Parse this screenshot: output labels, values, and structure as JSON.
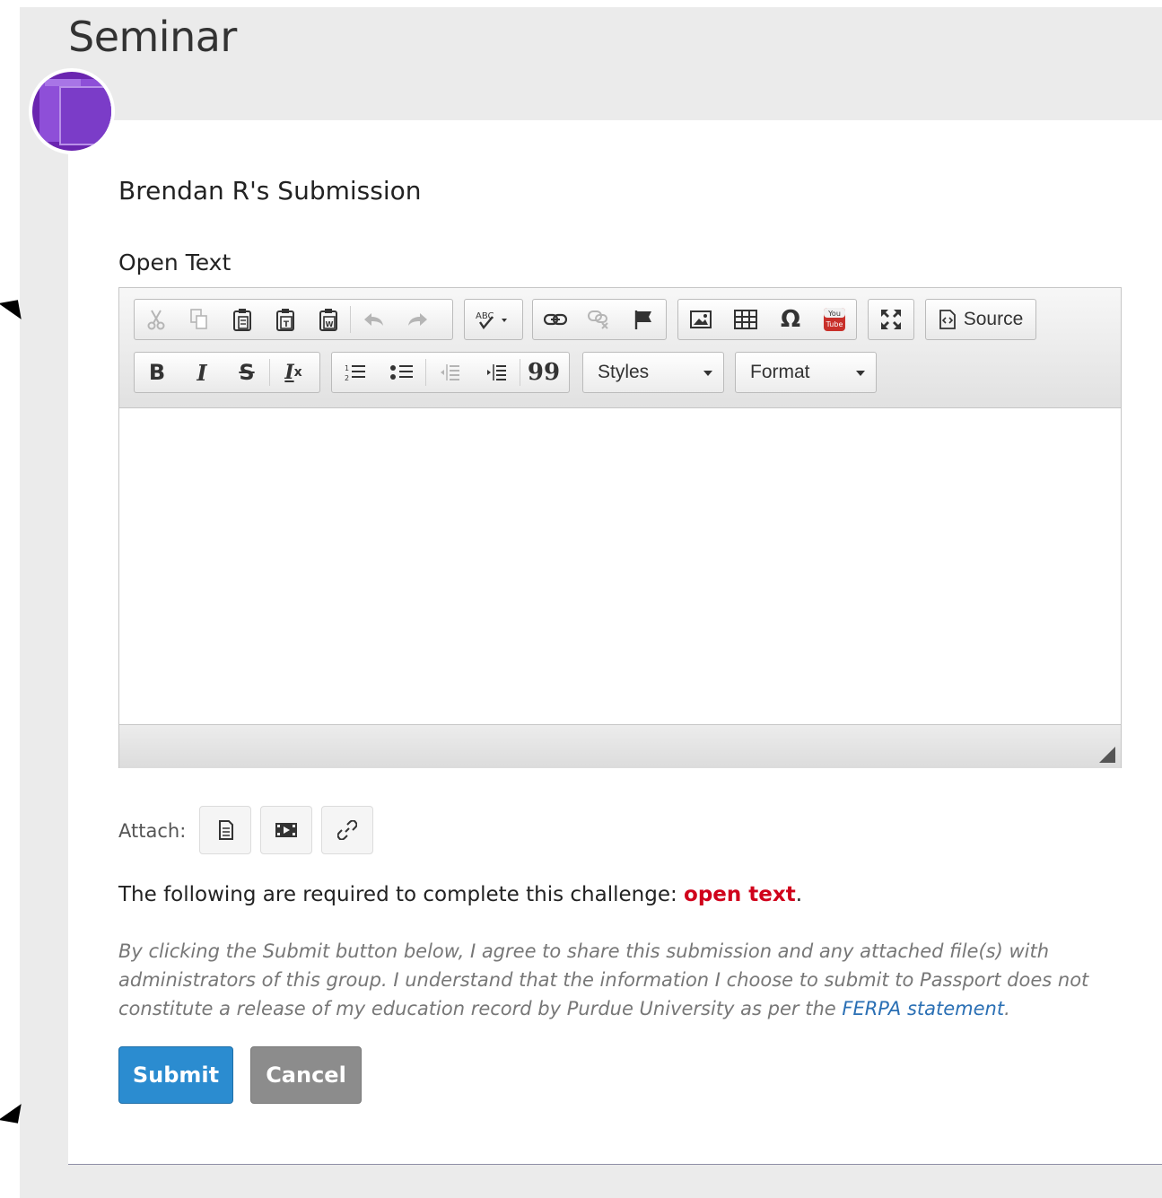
{
  "page": {
    "title": "Seminar"
  },
  "submission": {
    "title": "Brendan R's Submission",
    "section_label": "Open Text"
  },
  "editor": {
    "toolbar": {
      "row1": [
        {
          "name": "cut-icon",
          "enabled": false
        },
        {
          "name": "copy-icon",
          "enabled": false
        },
        {
          "name": "paste-icon",
          "enabled": true
        },
        {
          "name": "paste-text-icon",
          "enabled": true
        },
        {
          "name": "paste-word-icon",
          "enabled": true
        },
        {
          "name": "undo-icon",
          "enabled": false
        },
        {
          "name": "redo-icon",
          "enabled": false
        },
        {
          "name": "spellcheck-icon",
          "enabled": true
        },
        {
          "name": "link-icon",
          "enabled": true
        },
        {
          "name": "unlink-icon",
          "enabled": false
        },
        {
          "name": "anchor-flag-icon",
          "enabled": true
        },
        {
          "name": "image-icon",
          "enabled": true
        },
        {
          "name": "table-icon",
          "enabled": true
        },
        {
          "name": "special-char-icon",
          "enabled": true
        },
        {
          "name": "youtube-icon",
          "enabled": true
        },
        {
          "name": "maximize-icon",
          "enabled": true
        },
        {
          "name": "source-icon",
          "enabled": true
        }
      ],
      "source_label": "Source",
      "special_char_glyph": "Ω",
      "spellcheck_text": "ABC",
      "youtube_text_top": "You",
      "youtube_text_bottom": "Tube",
      "bold_glyph": "B",
      "italic_glyph": "I",
      "strike_glyph": "S",
      "remove_format_glyph": "I",
      "remove_format_sub": "x",
      "blockquote_glyph": "99",
      "styles_label": "Styles",
      "format_label": "Format"
    }
  },
  "attach": {
    "label": "Attach:",
    "buttons": [
      "file-icon",
      "video-icon",
      "link-icon"
    ]
  },
  "requirement": {
    "prefix": "The following are required to complete this challenge: ",
    "highlight": "open text",
    "suffix": "."
  },
  "disclaimer": {
    "text": "By clicking the Submit button below, I agree to share this submission and any attached file(s) with administrators of this group. I understand that the information I choose to submit to Passport does not constitute a release of my education record by Purdue University as per the ",
    "link_text": "FERPA statement",
    "suffix": "."
  },
  "actions": {
    "submit_label": "Submit",
    "cancel_label": "Cancel"
  },
  "colors": {
    "primary": "#2b8cd0",
    "cancel": "#8c8c8c",
    "required_highlight": "#d0021b",
    "link": "#2a6fb4",
    "avatar": "#6a25b0"
  }
}
